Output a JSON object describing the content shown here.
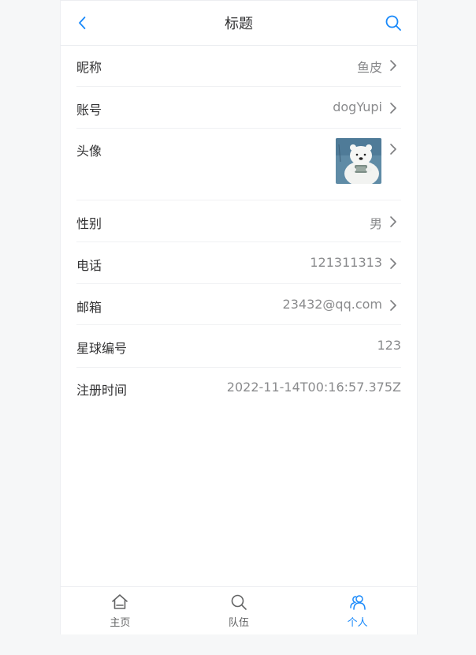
{
  "header": {
    "title": "标题",
    "back_icon": "chevron-left-icon",
    "search_icon": "search-icon",
    "accent_color": "#1989fa"
  },
  "profile_rows": [
    {
      "label": "昵称",
      "value": "鱼皮",
      "has_arrow": true
    },
    {
      "label": "账号",
      "value": "dogYupi",
      "has_arrow": true
    },
    {
      "label": "头像",
      "value": "",
      "has_arrow": true
    },
    {
      "label": "性别",
      "value": "男",
      "has_arrow": true
    },
    {
      "label": "电话",
      "value": "121311313",
      "has_arrow": true
    },
    {
      "label": "邮箱",
      "value": "23432@qq.com",
      "has_arrow": true
    },
    {
      "label": "星球编号",
      "value": "123",
      "has_arrow": false
    },
    {
      "label": "注册时间",
      "value": "2022-11-14T00:16:57.375Z",
      "has_arrow": false
    }
  ],
  "tabbar": {
    "items": [
      {
        "label": "主页",
        "icon": "home-icon",
        "active": false
      },
      {
        "label": "队伍",
        "icon": "search-icon",
        "active": false
      },
      {
        "label": "个人",
        "icon": "friends-icon",
        "active": true
      }
    ]
  }
}
